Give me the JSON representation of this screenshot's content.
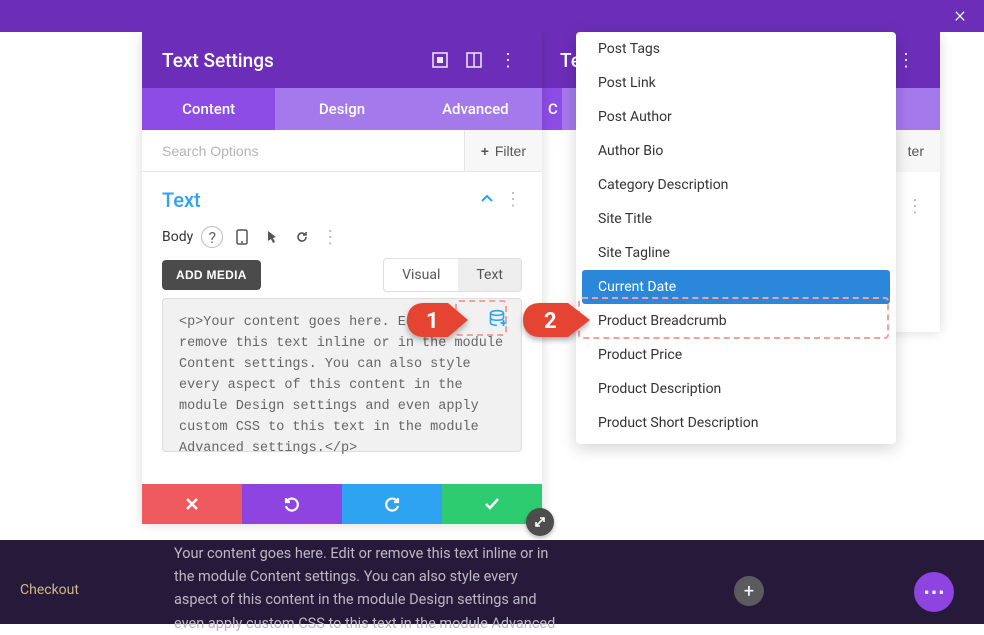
{
  "top": {
    "close_glyph": "×"
  },
  "left_panel": {
    "title": "Text Settings",
    "tabs": {
      "content": "Content",
      "design": "Design",
      "advanced": "Advanced"
    },
    "search_placeholder": "Search Options",
    "filter_label": "Filter",
    "section_title": "Text",
    "body_label": "Body",
    "add_media": "ADD MEDIA",
    "editor_tabs": {
      "visual": "Visual",
      "text": "Text"
    },
    "code": "<p>Your content goes here. Edit or remove this text inline or in the module Content settings. You can also style every aspect of this content in the module Design settings and even apply custom CSS to this text in the module Advanced settings.</p>"
  },
  "right_panel": {
    "title": "Text Settings",
    "tabs_first_letter": "C",
    "filter_label": "ter"
  },
  "option_list": [
    "Post Tags",
    "Post Link",
    "Post Author",
    "Author Bio",
    "Category Description",
    "Site Title",
    "Site Tagline",
    "Current Date",
    "Product Breadcrumb",
    "Product Price",
    "Product Description",
    "Product Short Description"
  ],
  "option_highlight_index": 7,
  "callouts": {
    "one": "1",
    "two": "2"
  },
  "strip": {
    "checkout": "Checkout",
    "body": "Your content goes here. Edit or remove this text inline or in the module Content settings. You can also style every aspect of this content in the module Design settings and even apply custom CSS to this text in the module Advanced"
  }
}
